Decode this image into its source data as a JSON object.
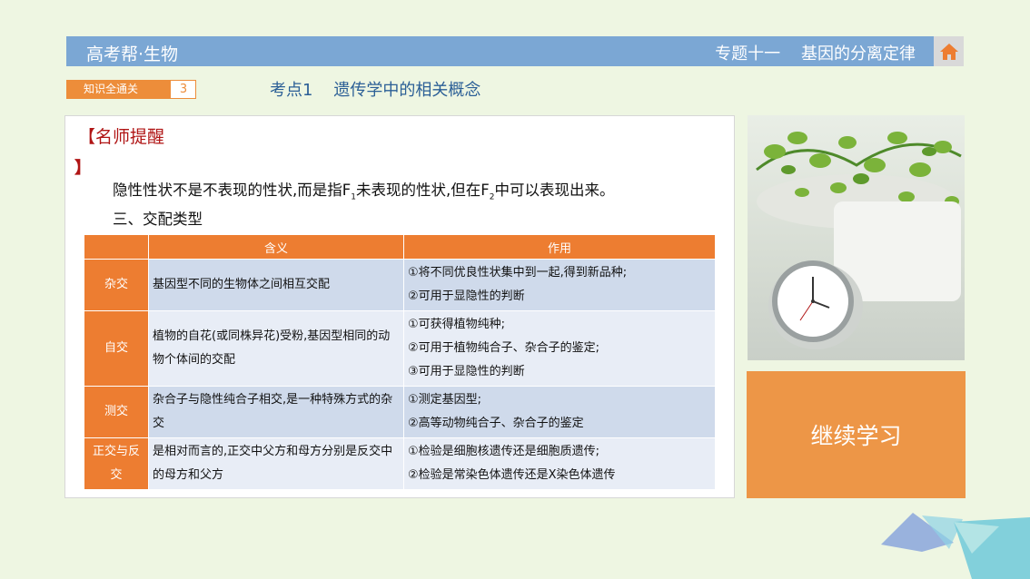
{
  "header": {
    "title": "高考帮·生物",
    "topic": "专题十一    基因的分离定律",
    "home_icon": "home-icon"
  },
  "tag": {
    "label": "知识全通关",
    "number": "3"
  },
  "heading": "考点1    遗传学中的相关概念",
  "tip": {
    "title": "【名师提醒",
    "bracket": "】",
    "text_a": "隐性性状不是不表现的性状,而是指F",
    "sub_a": "1",
    "text_b": "未表现的性状,但在F",
    "sub_b": "2",
    "text_c": "中可以表现出来。"
  },
  "section_title": "三、交配类型",
  "table": {
    "headers": [
      "",
      "含义",
      "作用"
    ],
    "rows": [
      {
        "type": "杂交",
        "meaning": "基因型不同的生物体之间相互交配",
        "uses": [
          "①将不同优良性状集中到一起,得到新品种;",
          "②可用于显隐性的判断"
        ]
      },
      {
        "type": "自交",
        "meaning": "植物的自花(或同株异花)受粉,基因型相同的动物个体间的交配",
        "uses": [
          "①可获得植物纯种;",
          "②可用于植物纯合子、杂合子的鉴定;",
          "③可用于显隐性的判断"
        ]
      },
      {
        "type": "测交",
        "meaning": "杂合子与隐性纯合子相交,是一种特殊方式的杂交",
        "uses": [
          "①测定基因型;",
          "②高等动物纯合子、杂合子的鉴定"
        ]
      },
      {
        "type": "正交与反交",
        "meaning": "是相对而言的,正交中父方和母方分别是反交中的母方和父方",
        "uses": [
          "①检验是细胞核遗传还是细胞质遗传;",
          "②检验是常染色体遗传还是X染色体遗传"
        ]
      }
    ]
  },
  "continue_button": "继续学习",
  "colors": {
    "accent": "#ed7d31",
    "header": "#7ba7d4",
    "background": "#eef6e2"
  }
}
